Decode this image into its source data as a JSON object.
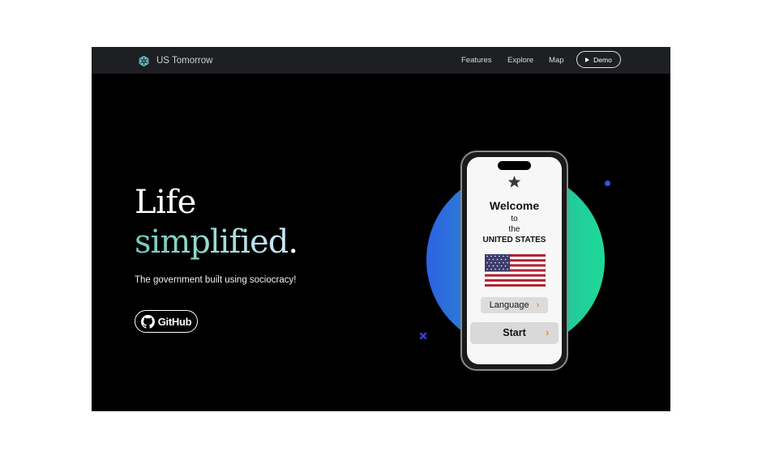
{
  "header": {
    "brand": "US Tomorrow",
    "nav": [
      {
        "label": "Features"
      },
      {
        "label": "Explore"
      },
      {
        "label": "Map"
      }
    ],
    "demo_label": "Demo"
  },
  "hero": {
    "line1": "Life",
    "line2": "simplified",
    "line2_suffix": ".",
    "tagline": "The government built using sociocracy!",
    "github_label": "GitHub"
  },
  "phone": {
    "welcome": "Welcome",
    "to": "to",
    "the": "the",
    "country": "UNITED STATES",
    "language_label": "Language",
    "start_label": "Start"
  },
  "colors": {
    "accent_gradient": [
      "#74c9b8",
      "#cde8ff"
    ],
    "circle_gradient": [
      "#2c63e2",
      "#1fd99a"
    ],
    "chevron": "#f08a24"
  },
  "icons": [
    "snowflake-logo-icon",
    "play-icon",
    "github-icon",
    "star-icon",
    "us-flag-icon",
    "chevron-right-icon",
    "x-mark-icon"
  ]
}
